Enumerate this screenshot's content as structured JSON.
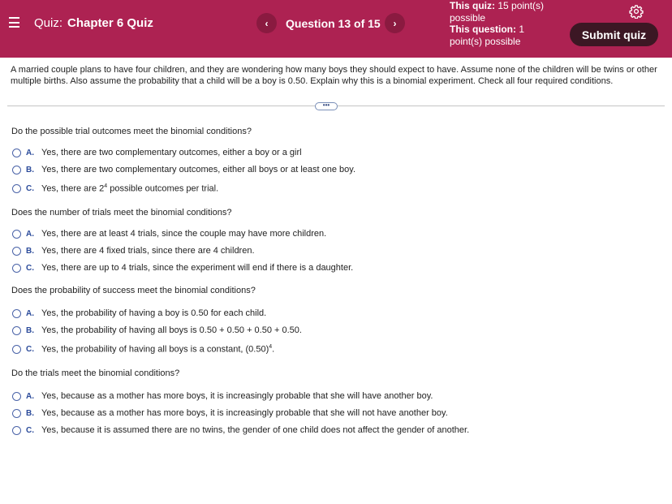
{
  "header": {
    "menu_icon": "hamburger-menu-icon",
    "quiz_prefix": "Quiz:",
    "quiz_name": "Chapter 6 Quiz",
    "prev_symbol": "‹",
    "next_symbol": "›",
    "question_label": "Question 13 of 15",
    "this_quiz_label": "This quiz:",
    "this_quiz_value": "15 point(s) possible",
    "this_question_label": "This question:",
    "this_question_value": "1 point(s) possible",
    "settings_icon": "gear-icon",
    "submit_label": "Submit quiz",
    "bar_color": "#ad2252",
    "submit_color": "#3c1724"
  },
  "problem": {
    "text": "A married couple plans to have four children, and they are wondering how many boys they should expect to have. Assume none of the children will be twins or other multiple births. Also assume the probability that a child will be a boy is 0.50. Explain why this is a binomial experiment. Check all four required conditions."
  },
  "expand_button": "•••",
  "questions": [
    {
      "prompt": "Do the possible trial outcomes meet the binomial conditions?",
      "options": [
        {
          "letter": "A.",
          "text": "Yes, there are two complementary outcomes, either a boy or a girl"
        },
        {
          "letter": "B.",
          "text": "Yes, there are two complementary outcomes, either all boys or at least one boy."
        },
        {
          "letter": "C.",
          "text_before": "Yes, there are 2",
          "sup": "4",
          "text_after": " possible outcomes per trial."
        }
      ]
    },
    {
      "prompt": "Does the number of trials meet the binomial conditions?",
      "options": [
        {
          "letter": "A.",
          "text": "Yes, there are at least 4 trials, since the couple may have more children."
        },
        {
          "letter": "B.",
          "text": "Yes, there are 4 fixed trials, since there are 4 children."
        },
        {
          "letter": "C.",
          "text": "Yes, there are up to 4 trials, since the experiment will end if there is a daughter."
        }
      ]
    },
    {
      "prompt": "Does the probability of success meet the binomial conditions?",
      "options": [
        {
          "letter": "A.",
          "text": "Yes, the probability of having a boy is 0.50 for each child."
        },
        {
          "letter": "B.",
          "text": "Yes, the probability of having all boys is 0.50 + 0.50 + 0.50 + 0.50."
        },
        {
          "letter": "C.",
          "text_before": "Yes, the probability of having all boys is a constant, (0.50)",
          "sup": "4",
          "text_after": "."
        }
      ]
    },
    {
      "prompt": "Do the trials meet the binomial conditions?",
      "options": [
        {
          "letter": "A.",
          "text": "Yes, because as a mother has more boys, it is increasingly probable that she will have another boy."
        },
        {
          "letter": "B.",
          "text": "Yes, because as a mother has more boys, it is increasingly probable that she will not have another boy."
        },
        {
          "letter": "C.",
          "text": "Yes, because it is assumed there are no twins, the gender of one child does not affect the gender of another."
        }
      ]
    }
  ]
}
